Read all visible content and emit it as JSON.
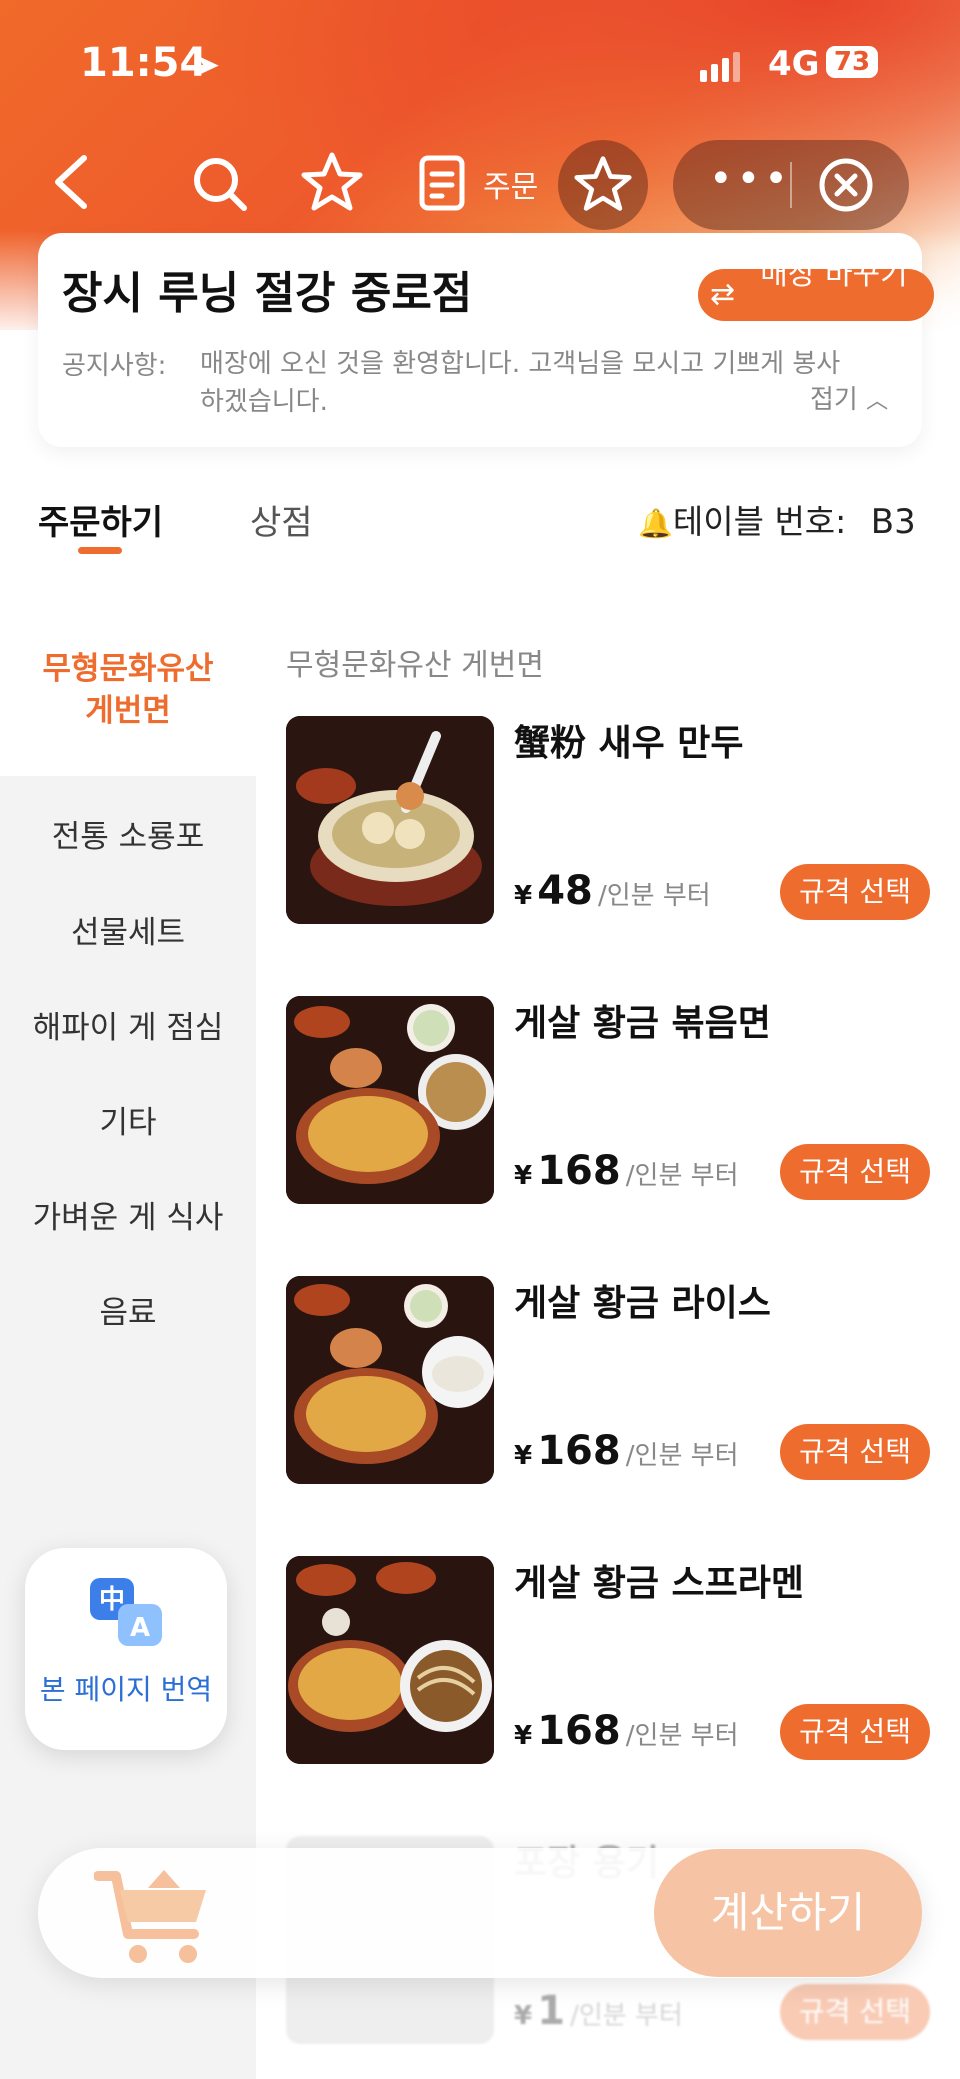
{
  "status_bar": {
    "time": "11:54",
    "network": "4G",
    "battery": "73"
  },
  "nav": {
    "order_label": "주문"
  },
  "store": {
    "name": "장시 루닝 절강 중로점",
    "switch_label": "매장 바꾸기",
    "notice_label": "공지사항:",
    "notice_text": "매장에 오신 것을 환영합니다. 고객님을 모시고 기쁘게 봉사하겠습니다.",
    "fold_label": "접기"
  },
  "tabs": {
    "order": "주문하기",
    "store": "상점"
  },
  "table": {
    "label": "테이블 번호:",
    "number": "B3"
  },
  "sidebar": {
    "items": [
      {
        "label": "무형문화유산\n게번면",
        "active": true
      },
      {
        "label": "전통 소룡포"
      },
      {
        "label": "선물세트"
      },
      {
        "label": "해파이 게 점심"
      },
      {
        "label": "기타"
      },
      {
        "label": "가벼운 게 식사"
      },
      {
        "label": "음료"
      }
    ]
  },
  "translate": {
    "icon_glyph_1": "中",
    "icon_glyph_2": "A",
    "label": "본 페이지 번역"
  },
  "section": {
    "title": "무형문화유산 게번면"
  },
  "products": [
    {
      "name": "蟹粉 새우 만두",
      "currency": "¥",
      "price": "48",
      "unit": "/인분 부터",
      "button": "규격 선택"
    },
    {
      "name": "게살 황금 볶음면",
      "currency": "¥",
      "price": "168",
      "unit": "/인분 부터",
      "button": "규격 선택"
    },
    {
      "name": "게살 황금 라이스",
      "currency": "¥",
      "price": "168",
      "unit": "/인분 부터",
      "button": "규격 선택"
    },
    {
      "name": "게살 황금 스프라멘",
      "currency": "¥",
      "price": "168",
      "unit": "/인분 부터",
      "button": "규격 선택"
    },
    {
      "name": "포장 용기",
      "currency": "¥",
      "price": "1",
      "unit": "/인분 부터",
      "button": "규격 선택"
    }
  ],
  "cart": {
    "checkout_label": "계산하기"
  },
  "colors": {
    "accent": "#ee6c2d",
    "link": "#2b6fd6"
  }
}
